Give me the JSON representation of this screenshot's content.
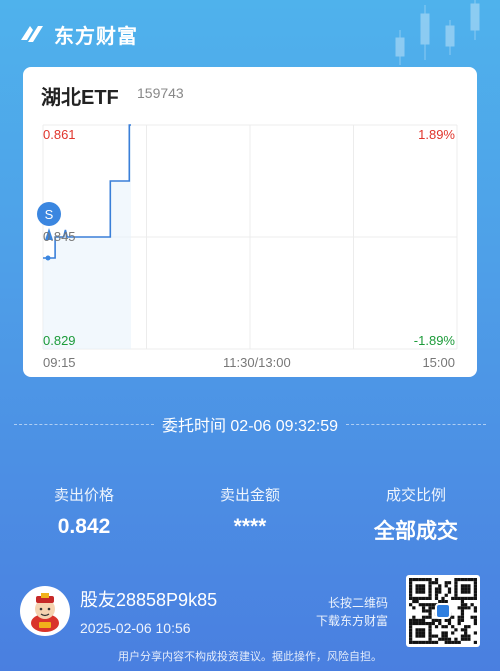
{
  "brand": {
    "name": "东方财富"
  },
  "stock": {
    "name": "湖北ETF",
    "code": "159743"
  },
  "chart_data": {
    "type": "line",
    "y_left_ticks": [
      "0.861",
      "0.845",
      "0.829"
    ],
    "y_right_ticks": [
      "1.89%",
      "",
      "-1.89%"
    ],
    "x_ticks": [
      "09:15",
      "11:30/13:00",
      "15:00"
    ],
    "ylim": [
      0.829,
      0.861
    ],
    "reference_price": 0.845,
    "series": [
      {
        "values_x_min": [
          0,
          1,
          1,
          7,
          7,
          12,
          13,
          14,
          14,
          39,
          39,
          50,
          50,
          51
        ],
        "values_y": [
          0.842,
          0.842,
          0.842,
          0.842,
          0.845,
          0.845,
          0.846,
          0.845,
          0.845,
          0.845,
          0.853,
          0.853,
          0.861,
          0.861
        ]
      }
    ],
    "sell_marker": {
      "label": "S",
      "time_min": 0,
      "price": 0.842
    }
  },
  "order": {
    "time_label": "委托时间",
    "time_value": "02-06 09:32:59"
  },
  "stats": [
    {
      "label": "卖出价格",
      "value": "0.842"
    },
    {
      "label": "卖出金额",
      "value": "****"
    },
    {
      "label": "成交比例",
      "value": "全部成交"
    }
  ],
  "user": {
    "name": "股友28858P9k85",
    "time": "2025-02-06 10:56"
  },
  "qr_tip": {
    "line1": "长按二维码",
    "line2": "下载东方财富"
  },
  "disclaimer": "用户分享内容不构成投资建议。据此操作，风险自担。",
  "colors": {
    "up": "#e0352c",
    "down": "#1d9b3a",
    "line": "#3a7fd8",
    "marker": "#3a86e0"
  }
}
